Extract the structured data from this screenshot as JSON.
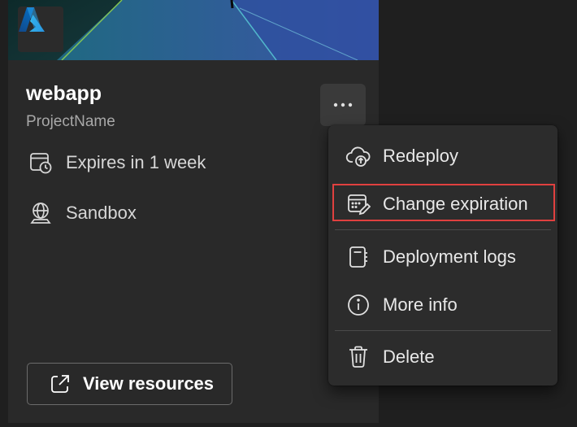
{
  "card": {
    "title": "webapp",
    "subtitle": "ProjectName",
    "expiry": "Expires in 1 week",
    "environment": "Sandbox",
    "view_resources_label": "View resources",
    "logo_icon": "azure-logo-icon",
    "more_icon": "more-horizontal-icon"
  },
  "menu": {
    "items": [
      {
        "label": "Redeploy",
        "icon": "cloud-upload-icon"
      },
      {
        "label": "Change expiration",
        "icon": "calendar-edit-icon",
        "highlighted": true
      },
      {
        "label": "Deployment logs",
        "icon": "notebook-icon"
      },
      {
        "label": "More info",
        "icon": "info-icon"
      },
      {
        "label": "Delete",
        "icon": "trash-icon"
      }
    ]
  },
  "colors": {
    "background": "#1f1f1f",
    "card": "#292929",
    "menu": "#2c2c2c",
    "highlight_border": "#e0403f",
    "azure_blue": "#0a78d4"
  }
}
